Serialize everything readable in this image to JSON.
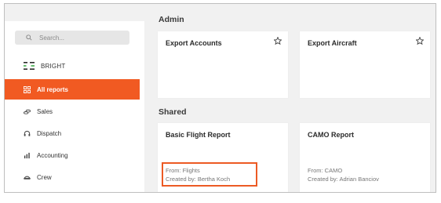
{
  "search": {
    "placeholder": "Search..."
  },
  "brand": {
    "name": "BRIGHT"
  },
  "nav": {
    "items": [
      {
        "label": "All reports"
      },
      {
        "label": "Sales"
      },
      {
        "label": "Dispatch"
      },
      {
        "label": "Accounting"
      },
      {
        "label": "Crew"
      }
    ]
  },
  "sections": {
    "admin": {
      "title": "Admin",
      "cards": [
        {
          "title": "Export Accounts"
        },
        {
          "title": "Export Aircraft"
        }
      ]
    },
    "shared": {
      "title": "Shared",
      "cards": [
        {
          "title": "Basic Flight Report",
          "from": "From: Flights",
          "created_by": "Created by: Bertha Koch"
        },
        {
          "title": "CAMO Report",
          "from": "From: CAMO",
          "created_by": "Created by: Adrian Banciov"
        }
      ]
    }
  },
  "colors": {
    "accent": "#f15a22",
    "highlight": "#ec5a24",
    "background": "#f1f1f1"
  }
}
